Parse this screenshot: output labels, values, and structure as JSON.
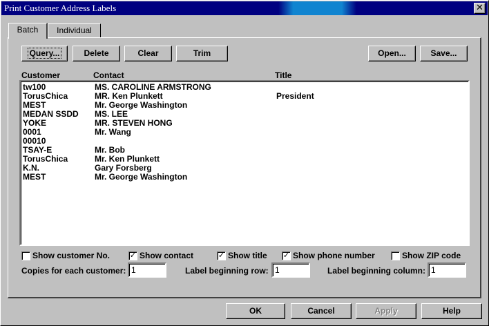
{
  "window": {
    "title": "Print Customer Address Labels",
    "close_glyph": "✕"
  },
  "tabs": [
    {
      "label": "Batch"
    },
    {
      "label": "Individual"
    }
  ],
  "toolbar": {
    "query_label": "Query...",
    "delete_label": "Delete",
    "clear_label": "Clear",
    "trim_label": "Trim",
    "open_label": "Open...",
    "save_label": "Save..."
  },
  "list": {
    "headers": {
      "customer": "Customer",
      "contact": "Contact",
      "title": "Title"
    },
    "rows": [
      {
        "customer": "tw100",
        "contact": "MS. CAROLINE ARMSTRONG",
        "title": ""
      },
      {
        "customer": "TorusChica",
        "contact": "MR. Ken Plunkett",
        "title": "President"
      },
      {
        "customer": "MEST",
        "contact": "Mr. George Washington",
        "title": ""
      },
      {
        "customer": "MEDAN SSDD",
        "contact": "MS. LEE",
        "title": ""
      },
      {
        "customer": "YOKE",
        "contact": "MR. STEVEN HONG",
        "title": ""
      },
      {
        "customer": "0001",
        "contact": "Mr. Wang",
        "title": ""
      },
      {
        "customer": "00010",
        "contact": "",
        "title": ""
      },
      {
        "customer": "TSAY-E",
        "contact": "Mr. Bob",
        "title": ""
      },
      {
        "customer": "TorusChica",
        "contact": "Mr. Ken Plunkett",
        "title": ""
      },
      {
        "customer": "K.N.",
        "contact": "Gary Forsberg",
        "title": ""
      },
      {
        "customer": "MEST",
        "contact": "Mr. George Washington",
        "title": ""
      }
    ]
  },
  "options": {
    "show_customer_no": {
      "label": "Show customer No.",
      "checked": false
    },
    "show_contact": {
      "label": "Show contact",
      "checked": true
    },
    "show_title": {
      "label": "Show title",
      "checked": true
    },
    "show_phone": {
      "label": "Show phone number",
      "checked": true
    },
    "show_zip": {
      "label": "Show ZIP code",
      "checked": false
    }
  },
  "fields": {
    "copies_label": "Copies for each customer:",
    "copies_value": "1",
    "row_label": "Label beginning row:",
    "row_value": "1",
    "column_label": "Label beginning column:",
    "column_value": "1"
  },
  "footer": {
    "ok_label": "OK",
    "cancel_label": "Cancel",
    "apply_label": "Apply",
    "help_label": "Help"
  },
  "check_glyph": "✓"
}
